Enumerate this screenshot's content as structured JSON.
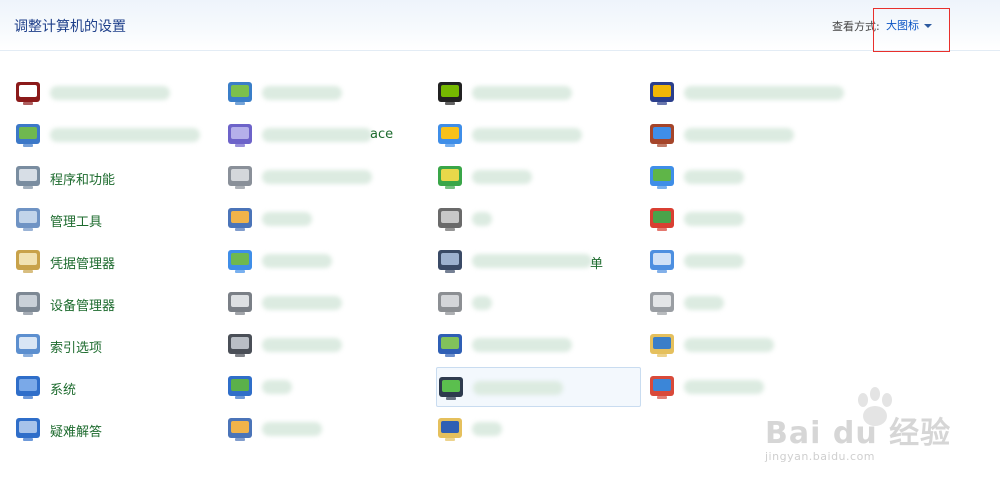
{
  "header": {
    "title": "调整计算机的设置",
    "view_label": "查看方式:",
    "view_value": "大图标"
  },
  "items": [
    {
      "label": "",
      "icon": "flash-player-icon",
      "blur": 120
    },
    {
      "label": "",
      "icon": "network-icon",
      "blur": 80
    },
    {
      "label": "",
      "icon": "nvidia-icon",
      "blur": 100
    },
    {
      "label": "",
      "icon": "realtek-audio-icon",
      "blur": 160
    },
    {
      "label": "",
      "icon": "sync-center-icon",
      "blur": 150
    },
    {
      "label": "ace",
      "icon": "cardspace-icon",
      "blur": 110
    },
    {
      "label": "",
      "icon": "windows-update-icon",
      "blur": 110
    },
    {
      "label": "",
      "icon": "firewall-icon",
      "blur": 110
    },
    {
      "label": "程序和功能",
      "icon": "programs-features-icon",
      "blur": 0
    },
    {
      "label": "",
      "icon": "phone-modem-icon",
      "blur": 110
    },
    {
      "label": "",
      "icon": "recovery-icon",
      "blur": 60
    },
    {
      "label": "",
      "icon": "display-icon",
      "blur": 60
    },
    {
      "label": "管理工具",
      "icon": "admin-tools-icon",
      "blur": 0
    },
    {
      "label": "",
      "icon": "users-icon",
      "blur": 50
    },
    {
      "label": "",
      "icon": "device-icon",
      "blur": 20
    },
    {
      "label": "",
      "icon": "windows-defender-icon",
      "blur": 60
    },
    {
      "label": "凭据管理器",
      "icon": "credential-manager-icon",
      "blur": 0
    },
    {
      "label": "",
      "icon": "internet-options-icon",
      "blur": 70
    },
    {
      "label": "单",
      "icon": "start-menu-icon",
      "blur": 120
    },
    {
      "label": "",
      "icon": "date-time-icon",
      "blur": 60
    },
    {
      "label": "设备管理器",
      "icon": "device-manager-icon",
      "blur": 0
    },
    {
      "label": "",
      "icon": "printers-icon",
      "blur": 80
    },
    {
      "label": "",
      "icon": "sound-icon",
      "blur": 20
    },
    {
      "label": "",
      "icon": "mouse-icon",
      "blur": 40
    },
    {
      "label": "索引选项",
      "icon": "indexing-options-icon",
      "blur": 0
    },
    {
      "label": "",
      "icon": "keyboard-icon",
      "blur": 80
    },
    {
      "label": "",
      "icon": "mobility-center-icon",
      "blur": 100
    },
    {
      "label": "",
      "icon": "folder-options-icon",
      "blur": 90
    },
    {
      "label": "系统",
      "icon": "system-icon",
      "blur": 0
    },
    {
      "label": "",
      "icon": "personalization-icon",
      "blur": 30
    },
    {
      "label": "",
      "icon": "performance-icon",
      "blur": 90
    },
    {
      "label": "",
      "icon": "color-management-icon",
      "blur": 80
    },
    {
      "label": "疑难解答",
      "icon": "troubleshooting-icon",
      "blur": 0
    },
    {
      "label": "",
      "icon": "user-accounts-icon",
      "blur": 60
    },
    {
      "label": "",
      "icon": "fonts-icon",
      "blur": 30
    }
  ],
  "watermark": {
    "text": "Bai du 经验",
    "url": "jingyan.baidu.com"
  },
  "colors": {
    "title": "#1e3f8a",
    "link_green": "#1d6b2e",
    "highlight_red": "#e8302c"
  }
}
